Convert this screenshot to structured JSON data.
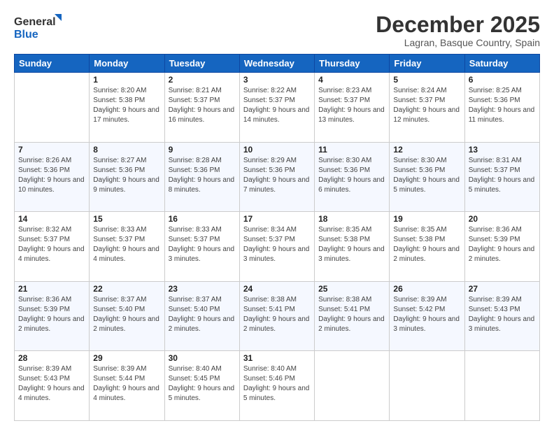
{
  "logo": {
    "line1": "General",
    "line2": "Blue"
  },
  "title": "December 2025",
  "location": "Lagran, Basque Country, Spain",
  "header_days": [
    "Sunday",
    "Monday",
    "Tuesday",
    "Wednesday",
    "Thursday",
    "Friday",
    "Saturday"
  ],
  "weeks": [
    [
      {
        "day": "",
        "sunrise": "",
        "sunset": "",
        "daylight": ""
      },
      {
        "day": "1",
        "sunrise": "Sunrise: 8:20 AM",
        "sunset": "Sunset: 5:38 PM",
        "daylight": "Daylight: 9 hours and 17 minutes."
      },
      {
        "day": "2",
        "sunrise": "Sunrise: 8:21 AM",
        "sunset": "Sunset: 5:37 PM",
        "daylight": "Daylight: 9 hours and 16 minutes."
      },
      {
        "day": "3",
        "sunrise": "Sunrise: 8:22 AM",
        "sunset": "Sunset: 5:37 PM",
        "daylight": "Daylight: 9 hours and 14 minutes."
      },
      {
        "day": "4",
        "sunrise": "Sunrise: 8:23 AM",
        "sunset": "Sunset: 5:37 PM",
        "daylight": "Daylight: 9 hours and 13 minutes."
      },
      {
        "day": "5",
        "sunrise": "Sunrise: 8:24 AM",
        "sunset": "Sunset: 5:37 PM",
        "daylight": "Daylight: 9 hours and 12 minutes."
      },
      {
        "day": "6",
        "sunrise": "Sunrise: 8:25 AM",
        "sunset": "Sunset: 5:36 PM",
        "daylight": "Daylight: 9 hours and 11 minutes."
      }
    ],
    [
      {
        "day": "7",
        "sunrise": "Sunrise: 8:26 AM",
        "sunset": "Sunset: 5:36 PM",
        "daylight": "Daylight: 9 hours and 10 minutes."
      },
      {
        "day": "8",
        "sunrise": "Sunrise: 8:27 AM",
        "sunset": "Sunset: 5:36 PM",
        "daylight": "Daylight: 9 hours and 9 minutes."
      },
      {
        "day": "9",
        "sunrise": "Sunrise: 8:28 AM",
        "sunset": "Sunset: 5:36 PM",
        "daylight": "Daylight: 9 hours and 8 minutes."
      },
      {
        "day": "10",
        "sunrise": "Sunrise: 8:29 AM",
        "sunset": "Sunset: 5:36 PM",
        "daylight": "Daylight: 9 hours and 7 minutes."
      },
      {
        "day": "11",
        "sunrise": "Sunrise: 8:30 AM",
        "sunset": "Sunset: 5:36 PM",
        "daylight": "Daylight: 9 hours and 6 minutes."
      },
      {
        "day": "12",
        "sunrise": "Sunrise: 8:30 AM",
        "sunset": "Sunset: 5:36 PM",
        "daylight": "Daylight: 9 hours and 5 minutes."
      },
      {
        "day": "13",
        "sunrise": "Sunrise: 8:31 AM",
        "sunset": "Sunset: 5:37 PM",
        "daylight": "Daylight: 9 hours and 5 minutes."
      }
    ],
    [
      {
        "day": "14",
        "sunrise": "Sunrise: 8:32 AM",
        "sunset": "Sunset: 5:37 PM",
        "daylight": "Daylight: 9 hours and 4 minutes."
      },
      {
        "day": "15",
        "sunrise": "Sunrise: 8:33 AM",
        "sunset": "Sunset: 5:37 PM",
        "daylight": "Daylight: 9 hours and 4 minutes."
      },
      {
        "day": "16",
        "sunrise": "Sunrise: 8:33 AM",
        "sunset": "Sunset: 5:37 PM",
        "daylight": "Daylight: 9 hours and 3 minutes."
      },
      {
        "day": "17",
        "sunrise": "Sunrise: 8:34 AM",
        "sunset": "Sunset: 5:37 PM",
        "daylight": "Daylight: 9 hours and 3 minutes."
      },
      {
        "day": "18",
        "sunrise": "Sunrise: 8:35 AM",
        "sunset": "Sunset: 5:38 PM",
        "daylight": "Daylight: 9 hours and 3 minutes."
      },
      {
        "day": "19",
        "sunrise": "Sunrise: 8:35 AM",
        "sunset": "Sunset: 5:38 PM",
        "daylight": "Daylight: 9 hours and 2 minutes."
      },
      {
        "day": "20",
        "sunrise": "Sunrise: 8:36 AM",
        "sunset": "Sunset: 5:39 PM",
        "daylight": "Daylight: 9 hours and 2 minutes."
      }
    ],
    [
      {
        "day": "21",
        "sunrise": "Sunrise: 8:36 AM",
        "sunset": "Sunset: 5:39 PM",
        "daylight": "Daylight: 9 hours and 2 minutes."
      },
      {
        "day": "22",
        "sunrise": "Sunrise: 8:37 AM",
        "sunset": "Sunset: 5:40 PM",
        "daylight": "Daylight: 9 hours and 2 minutes."
      },
      {
        "day": "23",
        "sunrise": "Sunrise: 8:37 AM",
        "sunset": "Sunset: 5:40 PM",
        "daylight": "Daylight: 9 hours and 2 minutes."
      },
      {
        "day": "24",
        "sunrise": "Sunrise: 8:38 AM",
        "sunset": "Sunset: 5:41 PM",
        "daylight": "Daylight: 9 hours and 2 minutes."
      },
      {
        "day": "25",
        "sunrise": "Sunrise: 8:38 AM",
        "sunset": "Sunset: 5:41 PM",
        "daylight": "Daylight: 9 hours and 2 minutes."
      },
      {
        "day": "26",
        "sunrise": "Sunrise: 8:39 AM",
        "sunset": "Sunset: 5:42 PM",
        "daylight": "Daylight: 9 hours and 3 minutes."
      },
      {
        "day": "27",
        "sunrise": "Sunrise: 8:39 AM",
        "sunset": "Sunset: 5:43 PM",
        "daylight": "Daylight: 9 hours and 3 minutes."
      }
    ],
    [
      {
        "day": "28",
        "sunrise": "Sunrise: 8:39 AM",
        "sunset": "Sunset: 5:43 PM",
        "daylight": "Daylight: 9 hours and 4 minutes."
      },
      {
        "day": "29",
        "sunrise": "Sunrise: 8:39 AM",
        "sunset": "Sunset: 5:44 PM",
        "daylight": "Daylight: 9 hours and 4 minutes."
      },
      {
        "day": "30",
        "sunrise": "Sunrise: 8:40 AM",
        "sunset": "Sunset: 5:45 PM",
        "daylight": "Daylight: 9 hours and 5 minutes."
      },
      {
        "day": "31",
        "sunrise": "Sunrise: 8:40 AM",
        "sunset": "Sunset: 5:46 PM",
        "daylight": "Daylight: 9 hours and 5 minutes."
      },
      {
        "day": "",
        "sunrise": "",
        "sunset": "",
        "daylight": ""
      },
      {
        "day": "",
        "sunrise": "",
        "sunset": "",
        "daylight": ""
      },
      {
        "day": "",
        "sunrise": "",
        "sunset": "",
        "daylight": ""
      }
    ]
  ]
}
